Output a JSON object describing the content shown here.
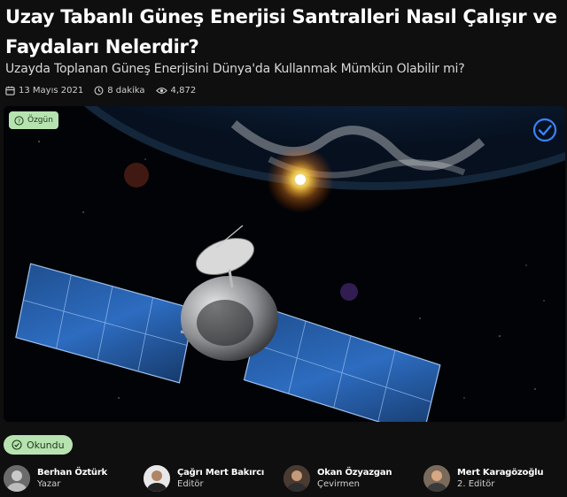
{
  "article": {
    "title": "Uzay Tabanlı Güneş Enerjisi Santralleri Nasıl Çalışır ve Faydaları Nelerdir?",
    "subtitle": "Uzayda Toplanan Güneş Enerjisini Dünya'da Kullanmak Mümkün Olabilir mi?",
    "date": "13 Mayıs 2021",
    "read_time": "8 dakika",
    "views": "4,872",
    "badge_label": "Özgün",
    "read_label": "Okundu"
  },
  "icons": {
    "date": "calendar-icon",
    "time": "clock-icon",
    "views": "eye-icon",
    "badge": "question-circle-icon",
    "verified": "check-circle-icon",
    "read": "check-circle-icon"
  },
  "colors": {
    "background": "#0f0f10",
    "chip": "#b7e3b0",
    "chip_text": "#1c3a18",
    "verify_accent": "#3b82f6"
  },
  "authors": [
    {
      "name": "Berhan Öztürk",
      "role": "Yazar"
    },
    {
      "name": "Çağrı Mert Bakırcı",
      "role": "Editör"
    },
    {
      "name": "Okan Özyazgan",
      "role": "Çevirmen"
    },
    {
      "name": "Mert Karagözoğlu",
      "role": "2. Editör"
    }
  ]
}
